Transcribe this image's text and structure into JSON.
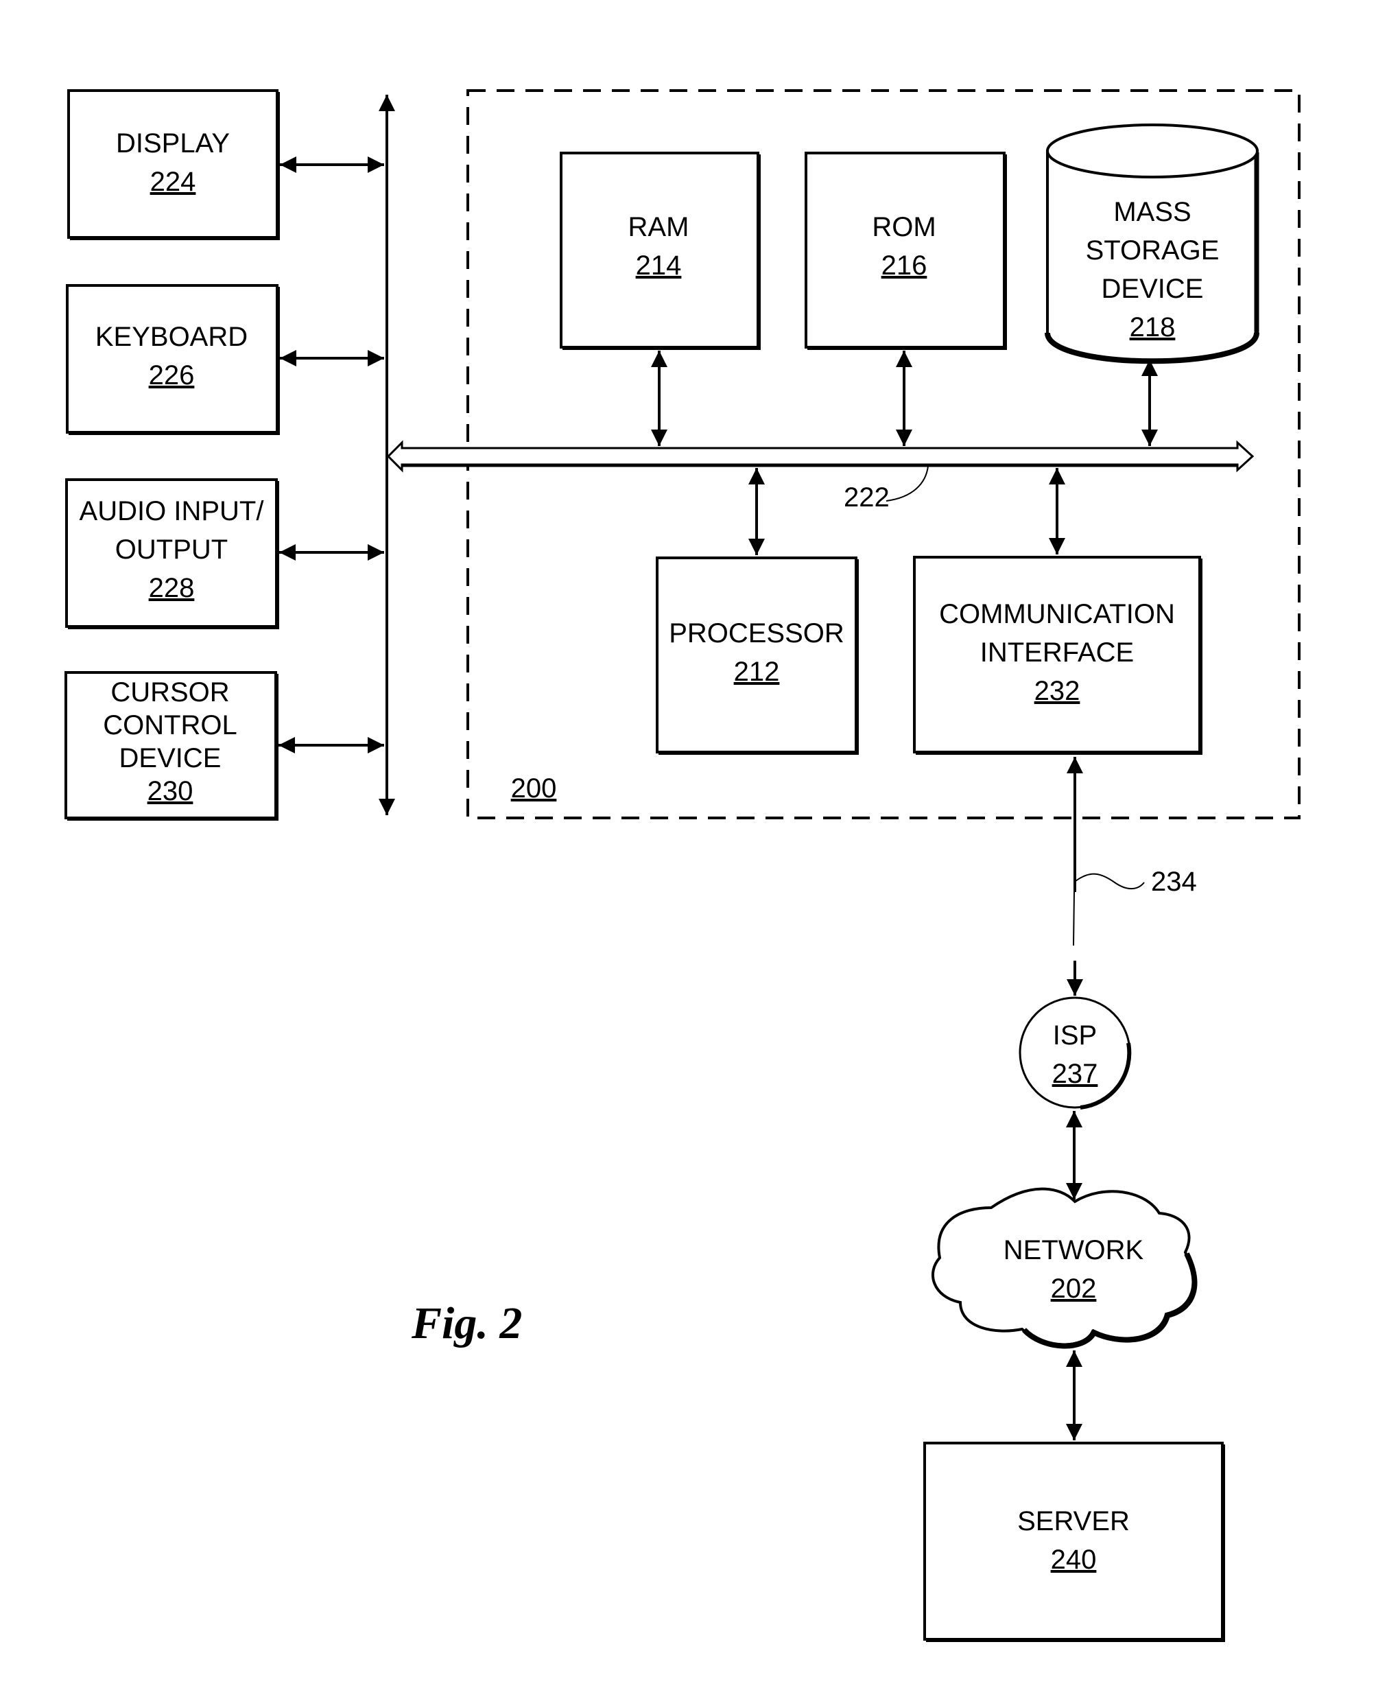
{
  "figure": {
    "caption": "Fig. 2",
    "system_label": "200",
    "bus_label": "222",
    "link_label": "234"
  },
  "peripherals": [
    {
      "id": "display",
      "lines": [
        "DISPLAY"
      ],
      "number": "224"
    },
    {
      "id": "keyboard",
      "lines": [
        "KEYBOARD"
      ],
      "number": "226"
    },
    {
      "id": "audio",
      "lines": [
        "AUDIO INPUT/",
        "OUTPUT"
      ],
      "number": "228"
    },
    {
      "id": "cursor",
      "lines": [
        "CURSOR",
        "CONTROL",
        "DEVICE"
      ],
      "number": "230"
    }
  ],
  "components": {
    "ram": {
      "lines": [
        "RAM"
      ],
      "number": "214"
    },
    "rom": {
      "lines": [
        "ROM"
      ],
      "number": "216"
    },
    "mass_storage": {
      "lines": [
        "MASS",
        "STORAGE",
        "DEVICE"
      ],
      "number": "218"
    },
    "processor": {
      "lines": [
        "PROCESSOR"
      ],
      "number": "212"
    },
    "comm_interface": {
      "lines": [
        "COMMUNICATION",
        "INTERFACE"
      ],
      "number": "232"
    }
  },
  "external": {
    "isp": {
      "lines": [
        "ISP"
      ],
      "number": "237"
    },
    "network": {
      "lines": [
        "NETWORK"
      ],
      "number": "202"
    },
    "server": {
      "lines": [
        "SERVER"
      ],
      "number": "240"
    }
  }
}
